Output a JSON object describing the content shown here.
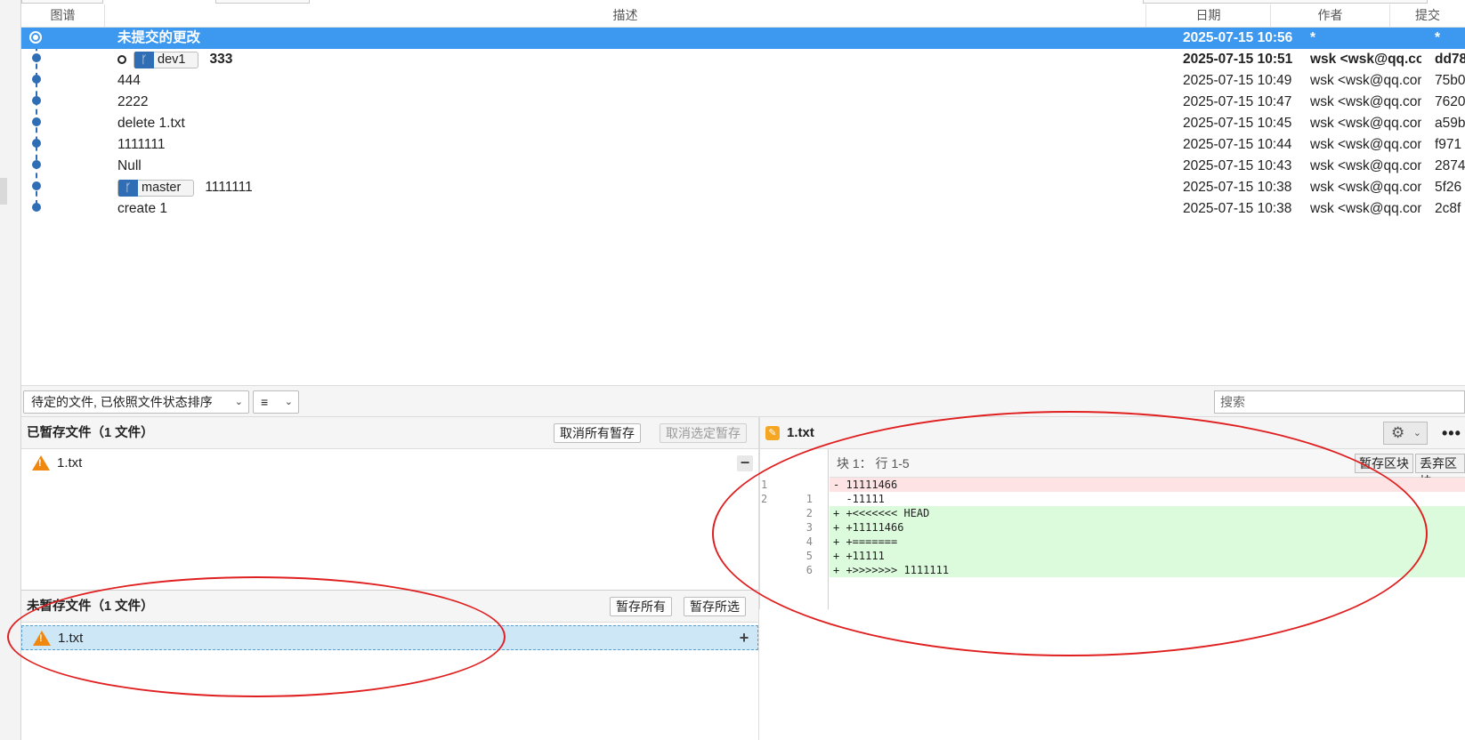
{
  "columns": {
    "graph": "图谱",
    "description": "描述",
    "date": "日期",
    "author": "作者",
    "hash": "提交"
  },
  "commits": [
    {
      "desc": "未提交的更改",
      "date": "2025-07-15 10:56",
      "author": "*",
      "hash": "*"
    },
    {
      "branch": "dev1",
      "desc": "333",
      "date": "2025-07-15 10:51",
      "author": "wsk <wsk@qq.com>",
      "hash": "dd78"
    },
    {
      "desc": "444",
      "date": "2025-07-15 10:49",
      "author": "wsk <wsk@qq.com>",
      "hash": "75b0"
    },
    {
      "desc": "2222",
      "date": "2025-07-15 10:47",
      "author": "wsk <wsk@qq.com>",
      "hash": "7620"
    },
    {
      "desc": "delete 1.txt",
      "date": "2025-07-15 10:45",
      "author": "wsk <wsk@qq.com>",
      "hash": "a59b"
    },
    {
      "desc": "1111111",
      "date": "2025-07-15 10:44",
      "author": "wsk <wsk@qq.com>",
      "hash": "f971"
    },
    {
      "desc": "Null",
      "date": "2025-07-15 10:43",
      "author": "wsk <wsk@qq.com>",
      "hash": "2874"
    },
    {
      "branch": "master",
      "desc": "1111111",
      "date": "2025-07-15 10:38",
      "author": "wsk <wsk@qq.com>",
      "hash": "5f26"
    },
    {
      "desc": "create 1",
      "date": "2025-07-15 10:38",
      "author": "wsk <wsk@qq.com>",
      "hash": "2c8f"
    }
  ],
  "toolbar": {
    "sort_label": "待定的文件, 已依照文件状态排序",
    "view_icon": "list-icon",
    "search_placeholder": "搜索"
  },
  "staged": {
    "title": "已暂存文件（1 文件）",
    "unstage_all": "取消所有暂存",
    "unstage_selected": "取消选定暂存",
    "files": [
      "1.txt"
    ]
  },
  "unstaged": {
    "title": "未暂存文件（1 文件）",
    "stage_all": "暂存所有",
    "stage_selected": "暂存所选",
    "files": [
      "1.txt"
    ]
  },
  "diff": {
    "file": "1.txt",
    "hunk_header": "块 1： 行 1-5",
    "stage_hunk": "暂存区块",
    "discard_hunk": "丢弃区块",
    "lines": [
      {
        "old": "1",
        "new": "",
        "type": "del",
        "text": "- 11111466"
      },
      {
        "old": "2",
        "new": "1",
        "type": "ctx",
        "text": "  -11111"
      },
      {
        "old": "",
        "new": "2",
        "type": "add",
        "text": "+ +<<<<<<< HEAD"
      },
      {
        "old": "",
        "new": "3",
        "type": "add",
        "text": "+ +11111466"
      },
      {
        "old": "",
        "new": "4",
        "type": "add",
        "text": "+ +======="
      },
      {
        "old": "",
        "new": "5",
        "type": "add",
        "text": "+ +11111"
      },
      {
        "old": "",
        "new": "6",
        "type": "add",
        "text": "+ +>>>>>>> 1111111"
      }
    ]
  },
  "colors": {
    "selection": "#3d99f0",
    "graph": "#2f6db5",
    "annotation": "#e02020",
    "warning": "#f0880f"
  }
}
